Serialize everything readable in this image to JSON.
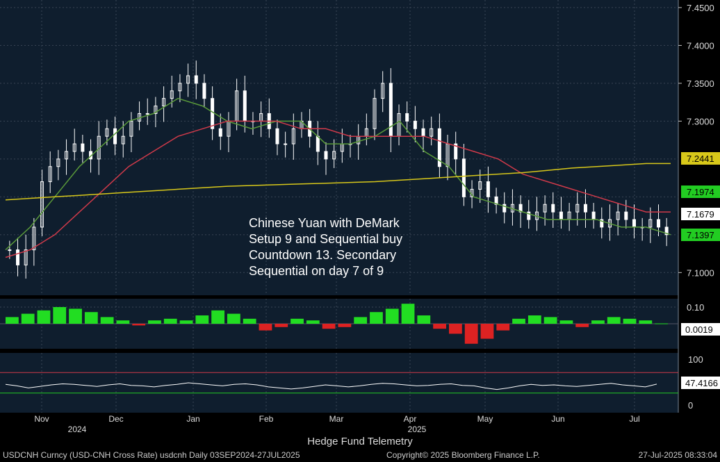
{
  "window": {
    "footer_left": "USDCNH Curncy (USD-CNH Cross Rate) usdcnh   Daily 03SEP2024-27JUL2025",
    "footer_mid": "Copyright© 2025 Bloomberg Finance L.P.",
    "footer_right": "27-Jul-2025 08:33:04",
    "credit": "Hedge Fund Telemetry"
  },
  "annotation": [
    "Chinese Yuan with DeMark",
    "Setup 9 and Sequential buy",
    "Countdown 13. Secondary",
    "Sequential on day 7 of 9"
  ],
  "colors": {
    "background": "#0f1e2e",
    "grid": "#3a4656",
    "candle": "#ffffff",
    "ma_short": "#5a9a3a",
    "ma_mid": "#d03a4a",
    "ma_long": "#d8c81a",
    "histogram_pos": "#22dd22",
    "histogram_neg": "#dd2222",
    "rsi": "#ffffff"
  },
  "chart_data": [
    {
      "type": "candlestick",
      "ylim": [
        7.07,
        7.46
      ],
      "yticks": [
        "7.4500",
        "7.4000",
        "7.3500",
        "7.3000",
        "7.1000"
      ],
      "xticks": [
        "Nov",
        "Dec",
        "Jan",
        "Feb",
        "Mar",
        "Apr",
        "May",
        "Jun",
        "Jul"
      ],
      "year_labels": [
        "2024",
        "2025"
      ],
      "closes": [
        7.13,
        7.11,
        7.13,
        7.16,
        7.22,
        7.24,
        7.25,
        7.26,
        7.27,
        7.26,
        7.25,
        7.28,
        7.29,
        7.27,
        7.28,
        7.3,
        7.31,
        7.31,
        7.32,
        7.33,
        7.34,
        7.35,
        7.36,
        7.35,
        7.33,
        7.29,
        7.28,
        7.3,
        7.34,
        7.3,
        7.3,
        7.31,
        7.29,
        7.27,
        7.27,
        7.29,
        7.3,
        7.28,
        7.26,
        7.25,
        7.26,
        7.27,
        7.27,
        7.28,
        7.29,
        7.33,
        7.35,
        7.28,
        7.31,
        7.3,
        7.29,
        7.28,
        7.29,
        7.24,
        7.27,
        7.25,
        7.2,
        7.21,
        7.22,
        7.2,
        7.19,
        7.18,
        7.19,
        7.18,
        7.17,
        7.18,
        7.19,
        7.18,
        7.17,
        7.18,
        7.19,
        7.18,
        7.17,
        7.16,
        7.17,
        7.18,
        7.17,
        7.16,
        7.16,
        7.17,
        7.16,
        7.15
      ],
      "price_labels": [
        "7.2441",
        "7.1974",
        "7.1679",
        "7.1397"
      ],
      "series": [
        {
          "name": "",
          "values": [
            7.13,
            7.16,
            7.2,
            7.24,
            7.27,
            7.3,
            7.31,
            7.33,
            7.32,
            7.3,
            7.29,
            7.3,
            7.3,
            7.27,
            7.27,
            7.28,
            7.3,
            7.26,
            7.24,
            7.2,
            7.19,
            7.18,
            7.17,
            7.17,
            7.17,
            7.16,
            7.16,
            7.15
          ]
        },
        {
          "name": "",
          "values": [
            7.12,
            7.13,
            7.15,
            7.18,
            7.21,
            7.24,
            7.26,
            7.28,
            7.29,
            7.3,
            7.3,
            7.3,
            7.29,
            7.29,
            7.28,
            7.28,
            7.28,
            7.28,
            7.27,
            7.26,
            7.25,
            7.23,
            7.22,
            7.21,
            7.2,
            7.19,
            7.18,
            7.18
          ]
        },
        {
          "name": "",
          "values": [
            7.196,
            7.198,
            7.2,
            7.202,
            7.204,
            7.206,
            7.208,
            7.21,
            7.212,
            7.214,
            7.215,
            7.216,
            7.217,
            7.218,
            7.219,
            7.22,
            7.222,
            7.224,
            7.226,
            7.228,
            7.23,
            7.232,
            7.235,
            7.238,
            7.24,
            7.242,
            7.244,
            7.244
          ]
        }
      ]
    },
    {
      "type": "bar",
      "ylim": [
        -0.15,
        0.15
      ],
      "yticks": [
        "0.10"
      ],
      "value_label": "0.0019",
      "values": [
        0.04,
        0.06,
        0.08,
        0.1,
        0.09,
        0.07,
        0.04,
        0.02,
        -0.01,
        0.02,
        0.03,
        0.02,
        0.05,
        0.08,
        0.06,
        0.03,
        -0.04,
        -0.02,
        0.03,
        0.02,
        -0.03,
        -0.02,
        0.04,
        0.07,
        0.09,
        0.12,
        0.05,
        -0.03,
        -0.06,
        -0.12,
        -0.09,
        -0.04,
        0.03,
        0.05,
        0.04,
        0.02,
        -0.02,
        0.02,
        0.04,
        0.03,
        0.02,
        0.0019
      ]
    },
    {
      "type": "line",
      "ylim": [
        0,
        100
      ],
      "yticks": [
        "100",
        "0"
      ],
      "value_label": "47.4166",
      "values": [
        47,
        44,
        40,
        43,
        46,
        48,
        47,
        45,
        43,
        46,
        48,
        45,
        44,
        42,
        45,
        47,
        50,
        48,
        46,
        44,
        47,
        48,
        46,
        42,
        40,
        38,
        40,
        43,
        46,
        44,
        42,
        44,
        47,
        49,
        48,
        46,
        44,
        45,
        47,
        48,
        45,
        44,
        40,
        37,
        40,
        44,
        47,
        45,
        46,
        44,
        43,
        45,
        47,
        49,
        46,
        44,
        42,
        47.4166
      ]
    }
  ]
}
